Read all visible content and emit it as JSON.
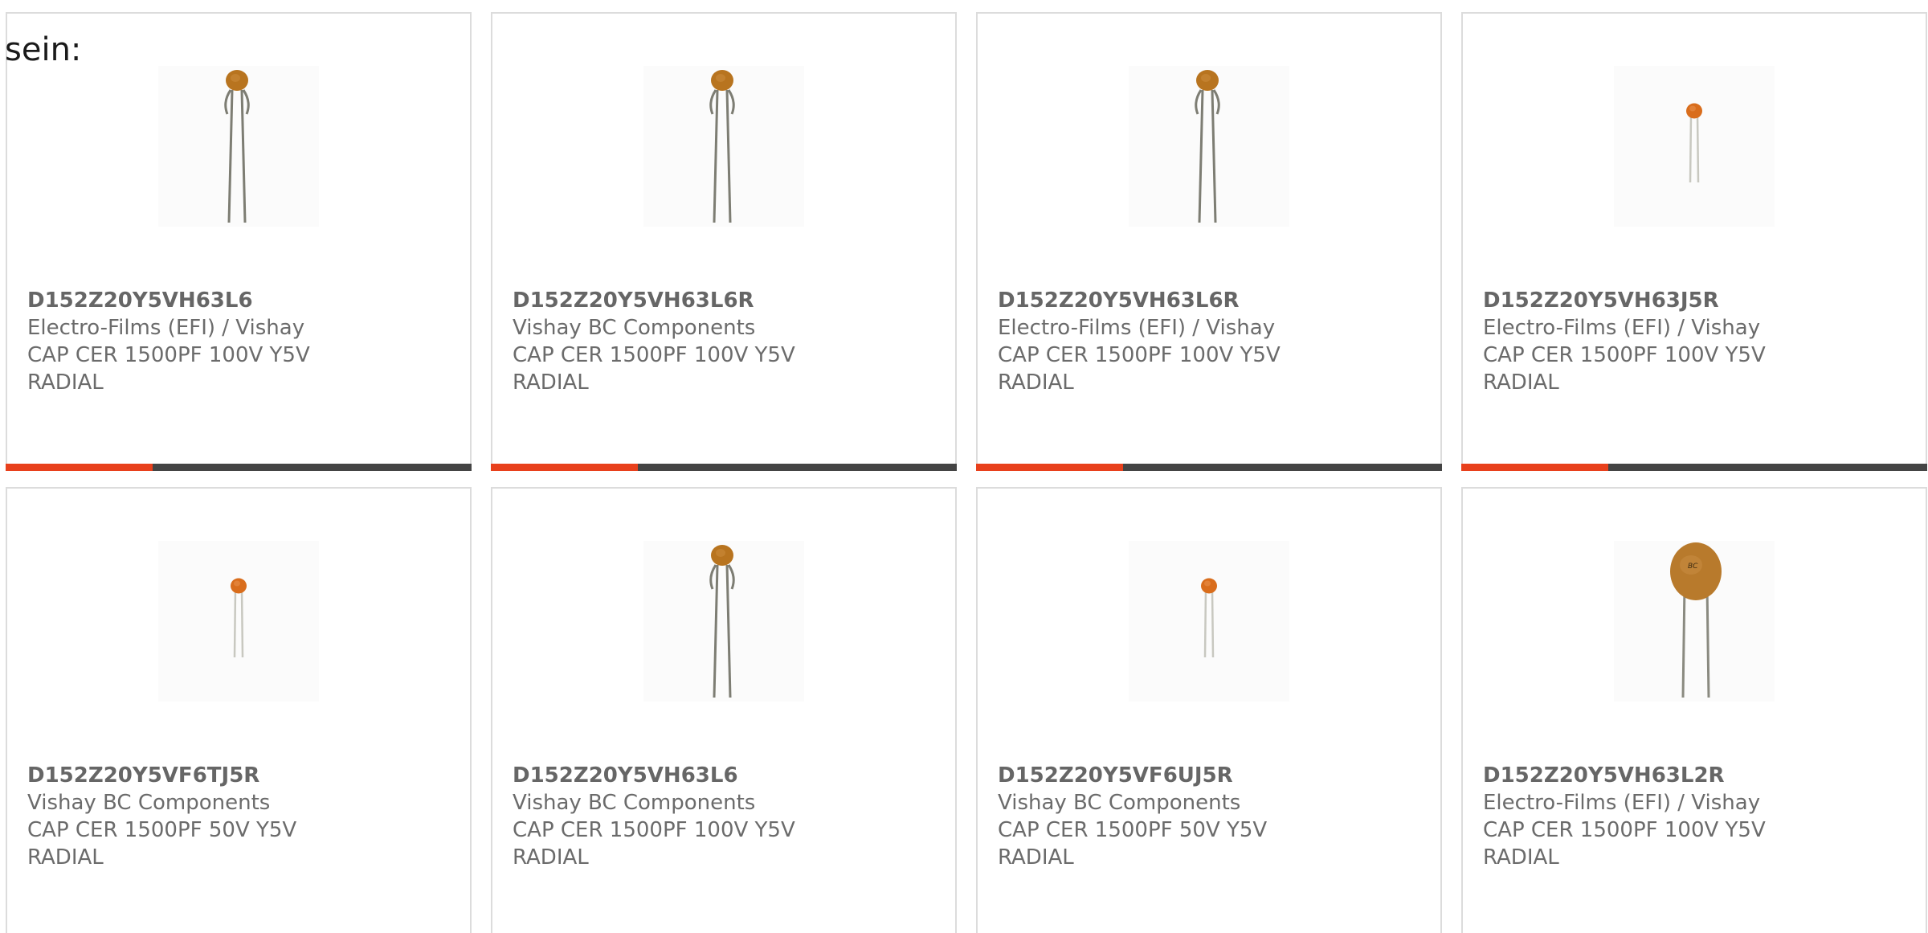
{
  "intro_text": "sein:",
  "accent_color": "#e8401c",
  "bar_color": "#444444",
  "products": [
    {
      "part_number": "D152Z20Y5VH63L6",
      "manufacturer": "Electro-Films (EFI) / Vishay",
      "desc_line1": "CAP CER 1500PF 100V Y5V",
      "desc_line2": "RADIAL",
      "image": "capacitor-long-leads-icon"
    },
    {
      "part_number": "D152Z20Y5VH63L6R",
      "manufacturer": "Vishay BC Components",
      "desc_line1": "CAP CER 1500PF 100V Y5V",
      "desc_line2": "RADIAL",
      "image": "capacitor-long-leads-icon"
    },
    {
      "part_number": "D152Z20Y5VH63L6R",
      "manufacturer": "Electro-Films (EFI) / Vishay",
      "desc_line1": "CAP CER 1500PF 100V Y5V",
      "desc_line2": "RADIAL",
      "image": "capacitor-long-leads-icon"
    },
    {
      "part_number": "D152Z20Y5VH63J5R",
      "manufacturer": "Electro-Films (EFI) / Vishay",
      "desc_line1": "CAP CER 1500PF 100V Y5V",
      "desc_line2": "RADIAL",
      "image": "capacitor-small-icon"
    },
    {
      "part_number": "D152Z20Y5VF6TJ5R",
      "manufacturer": "Vishay BC Components",
      "desc_line1": "CAP CER 1500PF 50V Y5V",
      "desc_line2": "RADIAL",
      "image": "capacitor-small-icon"
    },
    {
      "part_number": "D152Z20Y5VH63L6",
      "manufacturer": "Vishay BC Components",
      "desc_line1": "CAP CER 1500PF 100V Y5V",
      "desc_line2": "RADIAL",
      "image": "capacitor-long-leads-icon"
    },
    {
      "part_number": "D152Z20Y5VF6UJ5R",
      "manufacturer": "Vishay BC Components",
      "desc_line1": "CAP CER 1500PF 50V Y5V",
      "desc_line2": "RADIAL",
      "image": "capacitor-small-icon"
    },
    {
      "part_number": "D152Z20Y5VH63L2R",
      "manufacturer": "Electro-Films (EFI) / Vishay",
      "desc_line1": "CAP CER 1500PF 100V Y5V",
      "desc_line2": "RADIAL",
      "image": "capacitor-disc-icon"
    }
  ]
}
